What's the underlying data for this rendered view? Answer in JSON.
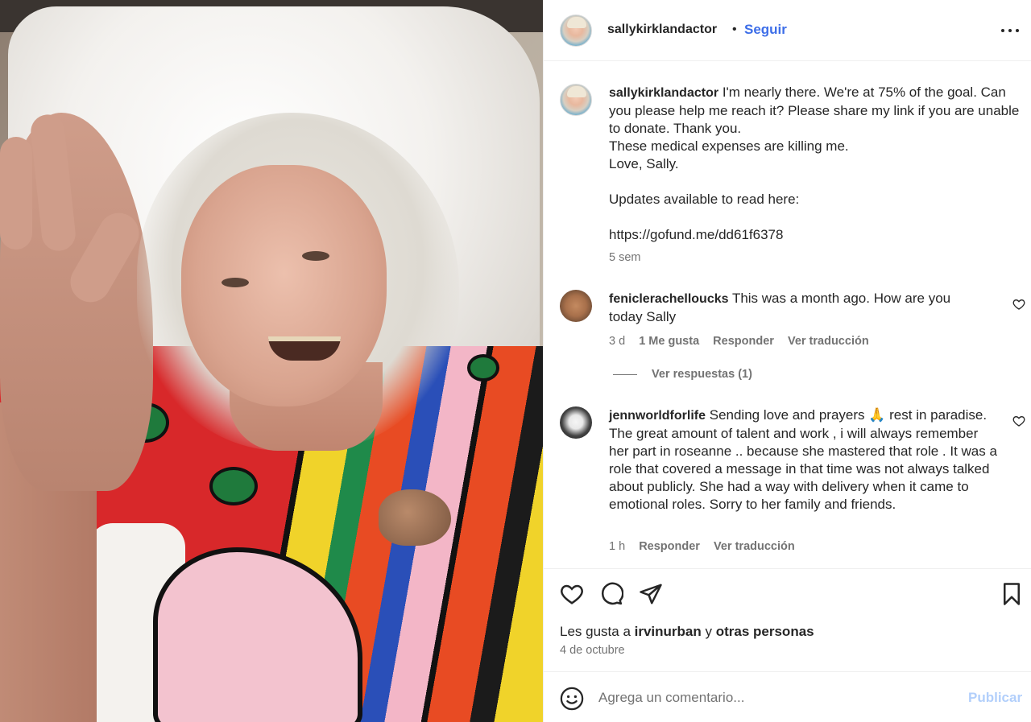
{
  "post": {
    "author": "sallykirklandactor",
    "separator": "•",
    "follow_label": "Seguir",
    "more_icon": "more-horizontal-icon"
  },
  "caption": {
    "username": "sallykirklandactor",
    "text": "I'm nearly there. We're at 75% of the goal. Can you please help me reach it? Please share my link if you are unable to donate. Thank you.\nThese medical expenses are killing me.\nLove, Sally.\n\nUpdates available to read here:\n\nhttps://gofund.me/dd61f6378",
    "time": "5 sem"
  },
  "comments": [
    {
      "username": "feniclerachelloucks",
      "text": "This was a month ago. How are you today Sally",
      "time": "3 d",
      "likes": "1 Me gusta",
      "reply": "Responder",
      "translate": "Ver traducción",
      "view_replies": "Ver respuestas (1)"
    },
    {
      "username": "jennworldforlife",
      "text": "Sending love and prayers 🙏 rest in paradise. The great amount of talent and work , i will always remember her part in roseanne .. because she mastered that role . It was a role that covered a message in that time was not always talked about publicly. She had a way with delivery when it came to emotional roles. Sorry to her family and friends.",
      "time": "1 h",
      "reply": "Responder",
      "translate": "Ver traducción"
    }
  ],
  "actions": {
    "icons": [
      "heart-icon",
      "comment-icon",
      "share-icon",
      "bookmark-icon"
    ],
    "likes_prefix": "Les gusta a",
    "likes_user": "irvinurban",
    "likes_conj": "y",
    "likes_others": "otras personas",
    "date": "4 de octubre"
  },
  "composer": {
    "placeholder": "Agrega un comentario...",
    "publish_label": "Publicar",
    "emoji_icon": "emoji-icon"
  },
  "colors": {
    "link": "#3d6ee8",
    "publish_disabled": "#b2cffb",
    "secondary_text": "#737373",
    "divider": "#efefef"
  }
}
